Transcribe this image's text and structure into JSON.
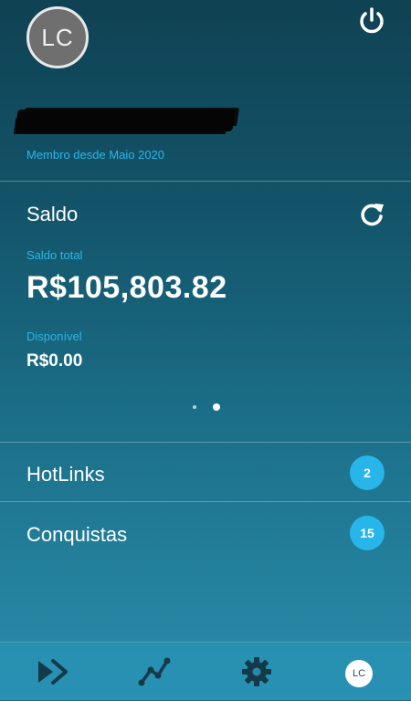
{
  "profile": {
    "initials": "LC",
    "member_since": "Membro desde Maio 2020"
  },
  "balance": {
    "title": "Saldo",
    "total_label": "Saldo total",
    "total_value": "R$105,803.82",
    "available_label": "Disponível",
    "available_value": "R$0.00",
    "pager": {
      "pages": 2,
      "active_page": 2
    }
  },
  "links": [
    {
      "label": "HotLinks",
      "count": "2"
    },
    {
      "label": "Conquistas",
      "count": "15"
    }
  ],
  "bottom_nav": {
    "items": [
      {
        "icon": "play-arrows-icon"
      },
      {
        "icon": "trend-line-icon"
      },
      {
        "icon": "gear-icon"
      },
      {
        "icon": "avatar",
        "initials": "LC"
      }
    ]
  },
  "icons": {
    "power": "power-icon",
    "refresh": "refresh-icon"
  },
  "colors": {
    "accent": "#2bb6e8",
    "badge": "#27b5ea",
    "background_top": "#0f4253",
    "background_bottom": "#2a8eac",
    "avatar_bg": "#6f6f6f"
  }
}
